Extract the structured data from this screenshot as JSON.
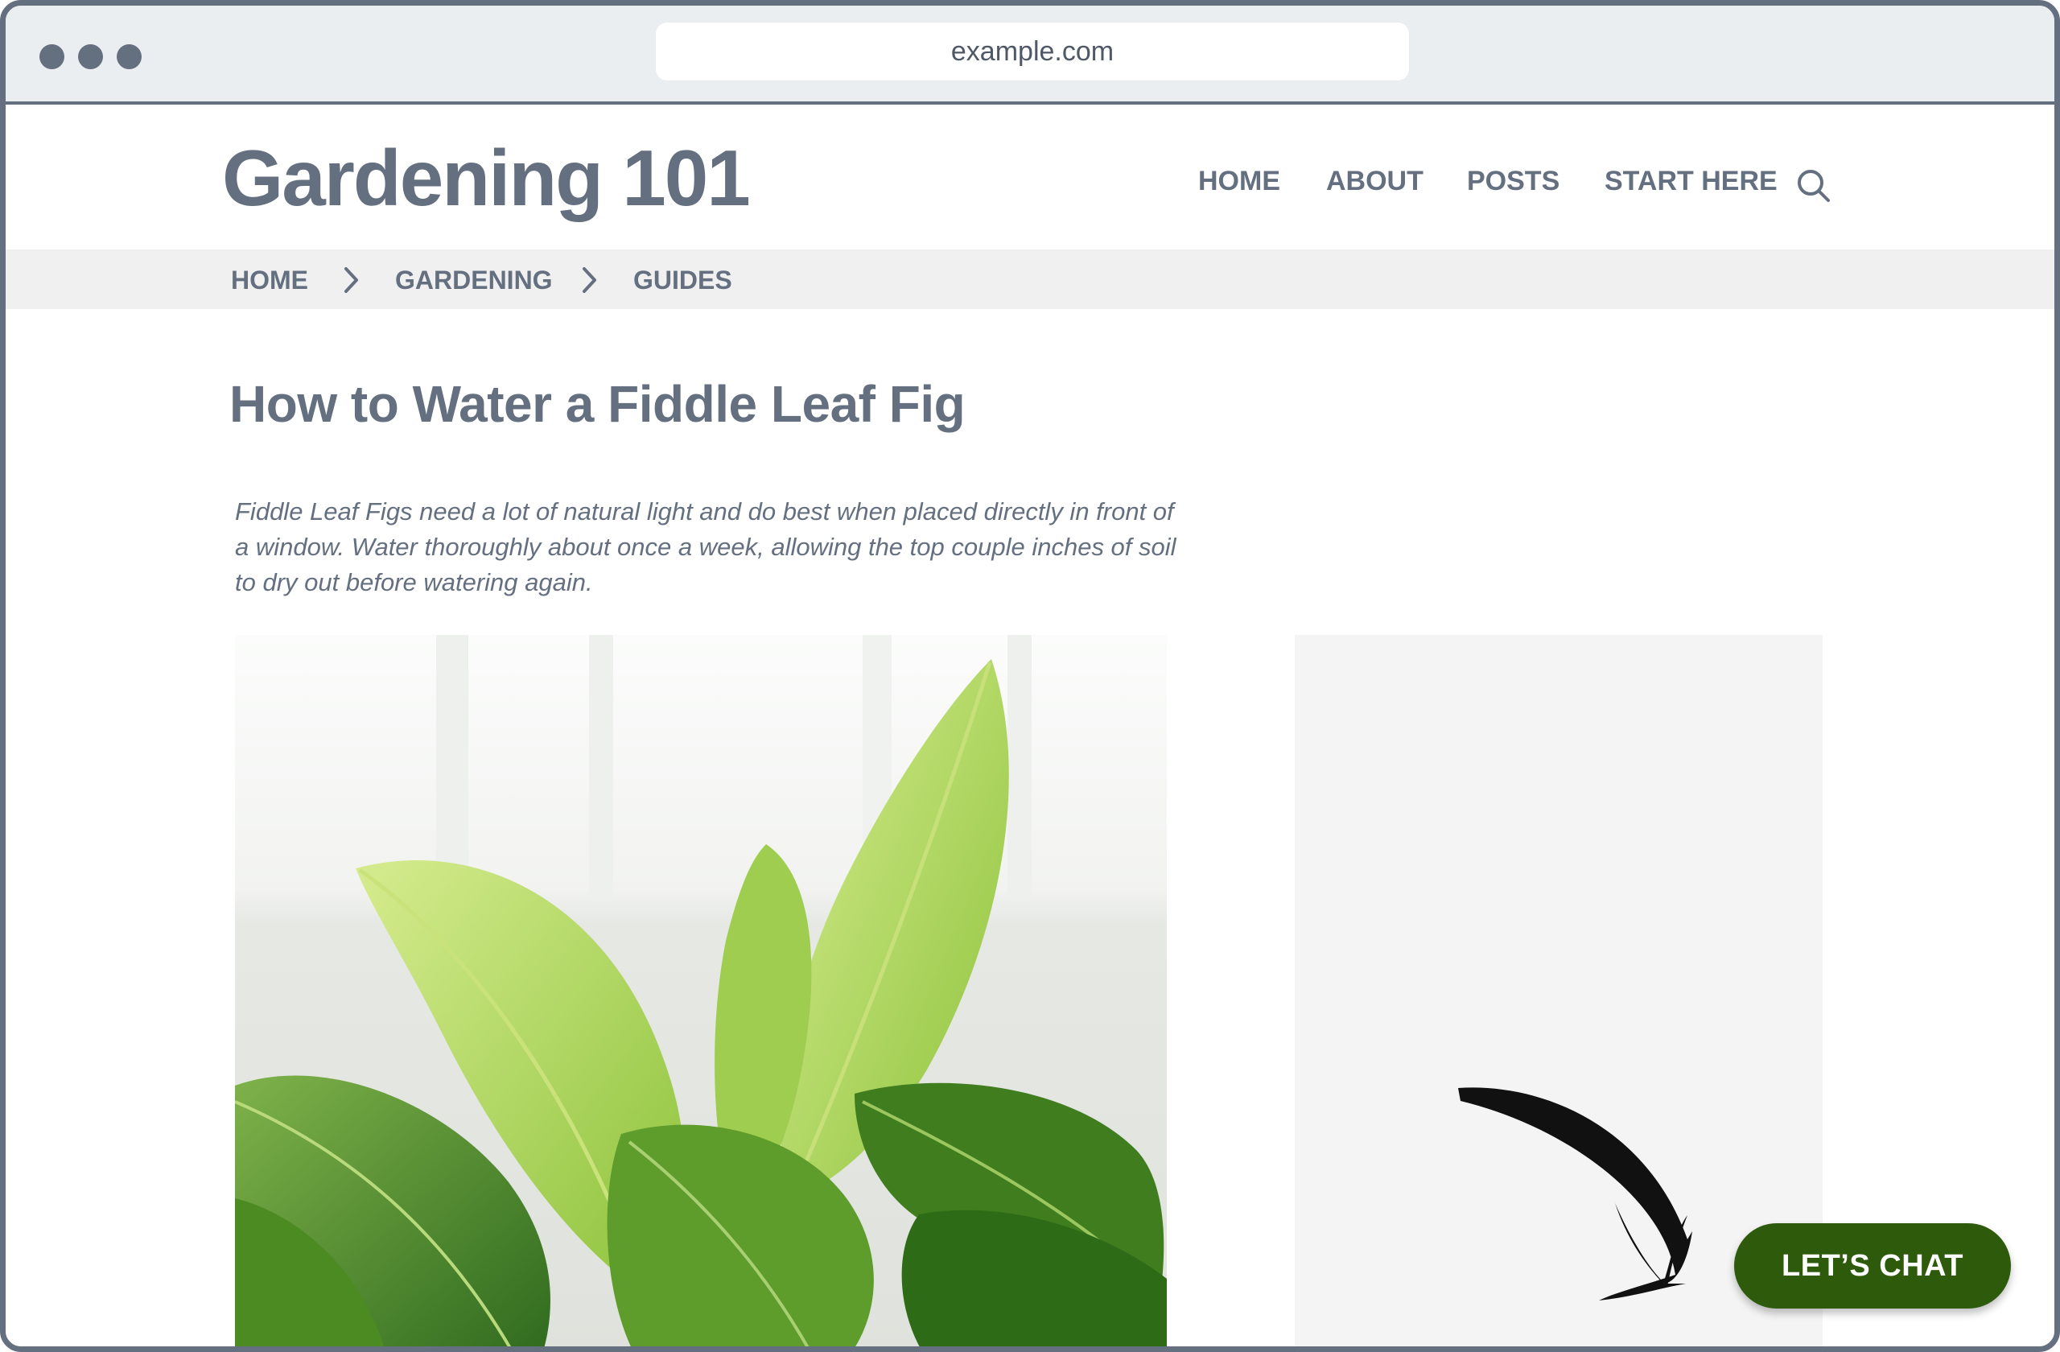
{
  "browser": {
    "url": "example.com"
  },
  "site": {
    "brand": "Gardening 101"
  },
  "nav": {
    "items": [
      "HOME",
      "ABOUT",
      "POSTS",
      "START HERE"
    ]
  },
  "breadcrumb": [
    "HOME",
    "GARDENING",
    "GUIDES"
  ],
  "article": {
    "title": "How to Water a Fiddle Leaf Fig",
    "excerpt": "Fiddle Leaf Figs need a lot of natural light and do best when placed directly in front of a window. Water thoroughly about once a week, allowing the top couple inches of soil to dry out before watering again."
  },
  "chat": {
    "label": "LET’S CHAT"
  },
  "colors": {
    "accent": "#2e5a0c",
    "text": "#646f80",
    "frame": "#646f80"
  }
}
